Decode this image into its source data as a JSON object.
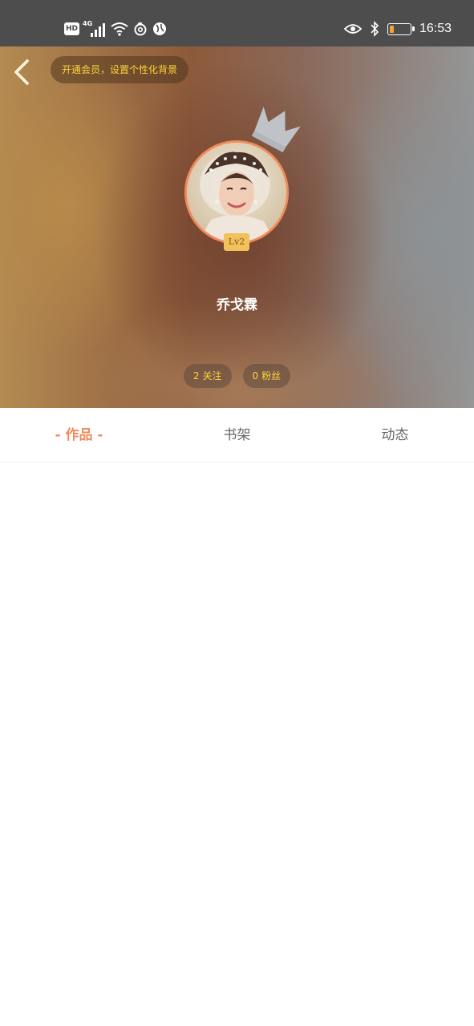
{
  "status_bar": {
    "hd_label": "HD",
    "network_label": "4G",
    "time": "16:53",
    "battery_level": 0.2,
    "battery_color": "#f4a431",
    "left_icons": [
      "hd-icon",
      "signal-4g-icon",
      "wifi-icon",
      "netease-music-icon",
      "browser-icon"
    ],
    "right_icons": [
      "eye-icon",
      "bluetooth-icon",
      "battery-icon"
    ]
  },
  "header": {
    "back_icon": "chevron-left-icon",
    "vip_banner": "开通会员，设置个性化背景",
    "username": "乔戈霖",
    "level": "Lv2",
    "stats": [
      {
        "count": "2",
        "label": "关注"
      },
      {
        "count": "0",
        "label": "粉丝"
      }
    ]
  },
  "tabs": [
    {
      "label": "- 作品 -",
      "active": true
    },
    {
      "label": "书架",
      "active": false
    },
    {
      "label": "动态",
      "active": false
    }
  ],
  "colors": {
    "accent": "#f08a5a",
    "highlight_text": "#ffd43b",
    "status_bar_bg": "#4d4d4d",
    "level_badge_bg": "#f2c15b"
  }
}
